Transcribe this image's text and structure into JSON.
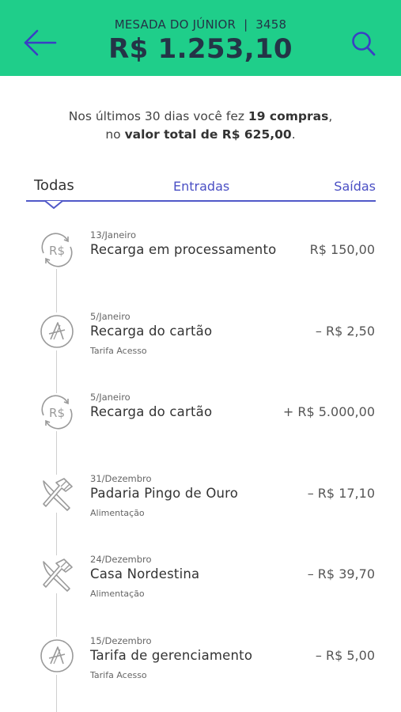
{
  "header": {
    "account_label": "MESADA DO JÚNIOR",
    "account_number": "3458",
    "balance": "R$ 1.253,10",
    "background": "#1fce8a",
    "back_icon": "arrow-left-icon",
    "search_icon": "search-icon"
  },
  "summary": {
    "line1_prefix": "Nos últimos 30 dias você fez ",
    "purchases": "19 compras",
    "line1_suffix": ",",
    "line2_prefix": "no ",
    "total_label": "valor total de R$ 625,00",
    "line2_suffix": "."
  },
  "tabs": {
    "all": "Todas",
    "incoming": "Entradas",
    "outgoing": "Saídas",
    "selected": "Todas",
    "accent": "#4a4fc4"
  },
  "transactions": [
    {
      "date": "13/Janeiro",
      "title": "Recarga em processamento",
      "category": "",
      "amount": "R$ 150,00",
      "icon": "recharge-icon"
    },
    {
      "date": "5/Janeiro",
      "title": "Recarga do cartão",
      "category": "Tarifa Acesso",
      "amount": "– R$ 2,50",
      "icon": "acesso-logo-icon"
    },
    {
      "date": "5/Janeiro",
      "title": "Recarga do cartão",
      "category": "",
      "amount": "+ R$ 5.000,00",
      "icon": "recharge-icon"
    },
    {
      "date": "31/Dezembro",
      "title": "Padaria Pingo de Ouro",
      "category": "Alimentação",
      "amount": "– R$ 17,10",
      "icon": "fork-knife-icon"
    },
    {
      "date": "24/Dezembro",
      "title": "Casa Nordestina",
      "category": "Alimentação",
      "amount": "– R$ 39,70",
      "icon": "fork-knife-icon"
    },
    {
      "date": "15/Dezembro",
      "title": "Tarifa de gerenciamento",
      "category": "Tarifa Acesso",
      "amount": "– R$ 5,00",
      "icon": "acesso-logo-icon"
    }
  ]
}
